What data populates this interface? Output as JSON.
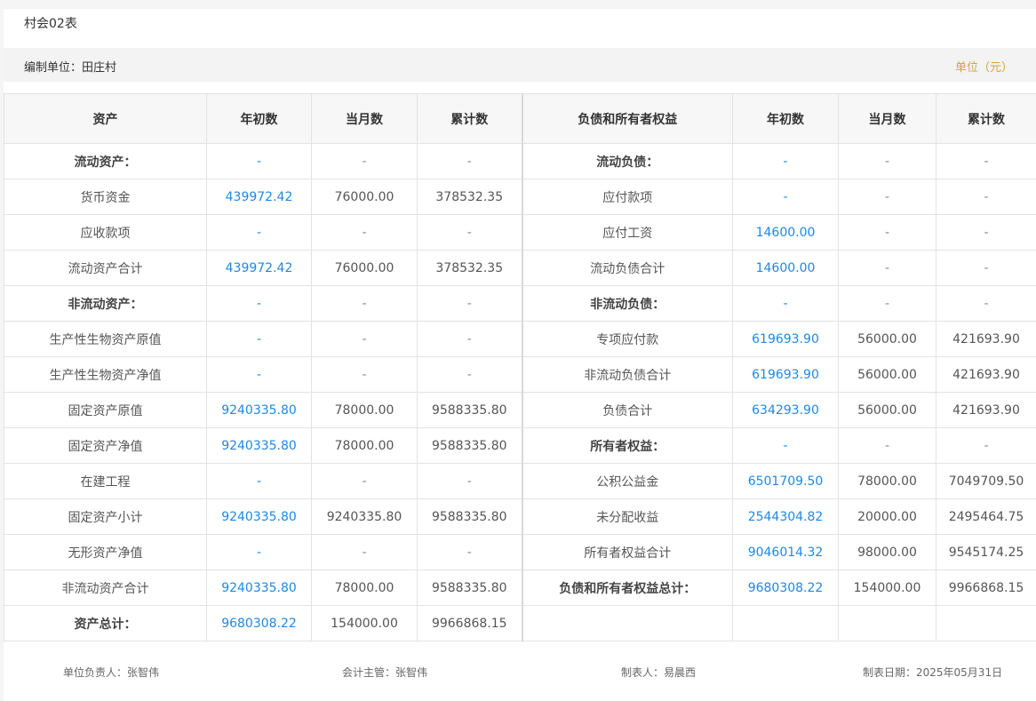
{
  "header": {
    "title": "村会02表",
    "unit_name": "编制单位：田庄村",
    "unit_label": "单位（元）"
  },
  "colors": {
    "link_blue": "#1e88e5",
    "unit_gold": "#d4a33b"
  },
  "columns": [
    "资产",
    "年初数",
    "当月数",
    "累计数",
    "负债和所有者权益",
    "年初数",
    "当月数",
    "累计数"
  ],
  "rows": [
    {
      "a_name": "流动资产：",
      "a_bold": true,
      "a_begin": "-",
      "a_month": "-",
      "a_total": "-",
      "l_name": "流动负债：",
      "l_bold": true,
      "l_begin": "-",
      "l_month": "-",
      "l_total": "-"
    },
    {
      "a_name": "货币资金",
      "a_bold": false,
      "a_begin": "439972.42",
      "a_month": "76000.00",
      "a_total": "378532.35",
      "l_name": "应付款项",
      "l_bold": false,
      "l_begin": "-",
      "l_month": "-",
      "l_total": "-"
    },
    {
      "a_name": "应收款项",
      "a_bold": false,
      "a_begin": "-",
      "a_month": "-",
      "a_total": "-",
      "l_name": "应付工资",
      "l_bold": false,
      "l_begin": "14600.00",
      "l_month": "-",
      "l_total": "-"
    },
    {
      "a_name": "流动资产合计",
      "a_bold": false,
      "a_begin": "439972.42",
      "a_month": "76000.00",
      "a_total": "378532.35",
      "l_name": "流动负债合计",
      "l_bold": false,
      "l_begin": "14600.00",
      "l_month": "-",
      "l_total": "-"
    },
    {
      "a_name": "非流动资产：",
      "a_bold": true,
      "a_begin": "-",
      "a_month": "-",
      "a_total": "-",
      "l_name": "非流动负债：",
      "l_bold": true,
      "l_begin": "-",
      "l_month": "-",
      "l_total": "-"
    },
    {
      "a_name": "生产性生物资产原值",
      "a_bold": false,
      "a_begin": "-",
      "a_month": "-",
      "a_total": "-",
      "l_name": "专项应付款",
      "l_bold": false,
      "l_begin": "619693.90",
      "l_month": "56000.00",
      "l_total": "421693.90"
    },
    {
      "a_name": "生产性生物资产净值",
      "a_bold": false,
      "a_begin": "-",
      "a_month": "-",
      "a_total": "-",
      "l_name": "非流动负债合计",
      "l_bold": false,
      "l_begin": "619693.90",
      "l_month": "56000.00",
      "l_total": "421693.90"
    },
    {
      "a_name": "固定资产原值",
      "a_bold": false,
      "a_begin": "9240335.80",
      "a_month": "78000.00",
      "a_total": "9588335.80",
      "l_name": "负债合计",
      "l_bold": false,
      "l_begin": "634293.90",
      "l_month": "56000.00",
      "l_total": "421693.90"
    },
    {
      "a_name": "固定资产净值",
      "a_bold": false,
      "a_begin": "9240335.80",
      "a_month": "78000.00",
      "a_total": "9588335.80",
      "l_name": "所有者权益：",
      "l_bold": true,
      "l_begin": "-",
      "l_month": "-",
      "l_total": "-"
    },
    {
      "a_name": "在建工程",
      "a_bold": false,
      "a_begin": "-",
      "a_month": "-",
      "a_total": "-",
      "l_name": "公积公益金",
      "l_bold": false,
      "l_begin": "6501709.50",
      "l_month": "78000.00",
      "l_total": "7049709.50"
    },
    {
      "a_name": "固定资产小计",
      "a_bold": false,
      "a_begin": "9240335.80",
      "a_month": "9240335.80",
      "a_total": "9588335.80",
      "l_name": "未分配收益",
      "l_bold": false,
      "l_begin": "2544304.82",
      "l_month": "20000.00",
      "l_total": "2495464.75"
    },
    {
      "a_name": "无形资产净值",
      "a_bold": false,
      "a_begin": "-",
      "a_month": "-",
      "a_total": "-",
      "l_name": "所有者权益合计",
      "l_bold": false,
      "l_begin": "9046014.32",
      "l_month": "98000.00",
      "l_total": "9545174.25"
    },
    {
      "a_name": "非流动资产合计",
      "a_bold": false,
      "a_begin": "9240335.80",
      "a_month": "78000.00",
      "a_total": "9588335.80",
      "l_name": "负债和所有者权益总计：",
      "l_bold": true,
      "l_begin": "9680308.22",
      "l_month": "154000.00",
      "l_total": "9966868.15"
    },
    {
      "a_name": "资产总计：",
      "a_bold": true,
      "a_begin": "9680308.22",
      "a_month": "154000.00",
      "a_total": "9966868.15",
      "l_name": "",
      "l_bold": false,
      "l_begin": "",
      "l_month": "",
      "l_total": ""
    }
  ],
  "footer": {
    "unit_head": "单位负责人：张智伟",
    "accounting_supervisor": "会计主管：张智伟",
    "preparer": "制表人：易晨西",
    "prepared_date": "制表日期：2025年05月31日"
  }
}
